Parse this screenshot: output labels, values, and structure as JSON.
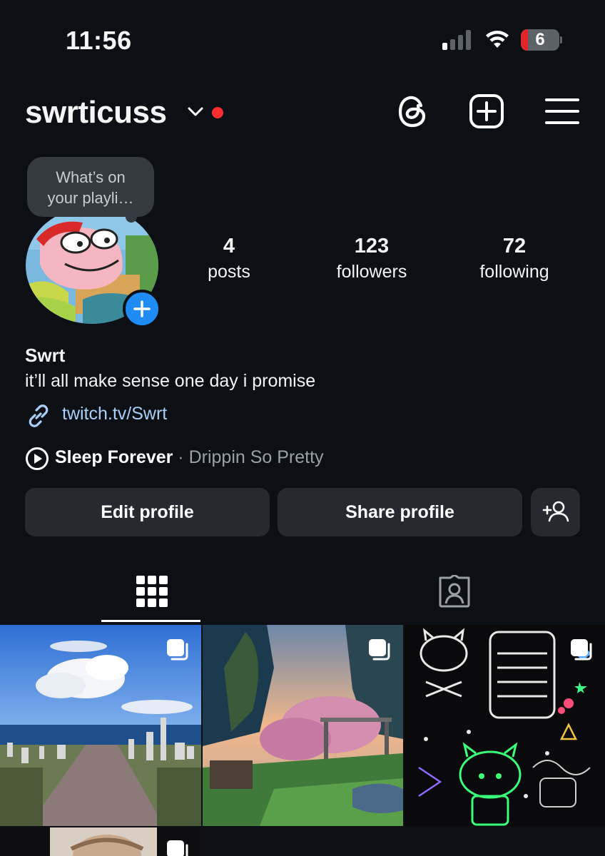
{
  "status_bar": {
    "time": "11:56",
    "battery_level": "6",
    "signal_bars_active": 1,
    "signal_bars_total": 4
  },
  "header": {
    "username": "swrticuss",
    "has_notification_dot": true,
    "icons": [
      "threads-icon",
      "create-post-icon",
      "menu-icon"
    ]
  },
  "note": {
    "text_line1": "What’s on",
    "text_line2": "your playli…"
  },
  "stats": {
    "posts": {
      "count": "4",
      "label": "posts"
    },
    "followers": {
      "count": "123",
      "label": "followers"
    },
    "following": {
      "count": "72",
      "label": "following"
    }
  },
  "bio": {
    "display_name": "Swrt",
    "text": "it’ll all make sense one day i promise",
    "link": "twitch.tv/Swrt"
  },
  "music": {
    "song": "Sleep Forever",
    "separator": " · ",
    "artist": "Drippin So Pretty"
  },
  "buttons": {
    "edit_profile": "Edit profile",
    "share_profile": "Share profile"
  },
  "tabs": {
    "active": "grid",
    "items": [
      "grid",
      "tagged"
    ]
  },
  "posts": [
    {
      "scene": "cemetery-by-sea",
      "multi": true
    },
    {
      "scene": "garden-gate-dusk",
      "multi": true
    },
    {
      "scene": "neon-kitty-collage",
      "multi": true
    },
    {
      "scene": "portrait-partial",
      "multi": true
    }
  ],
  "colors": {
    "background": "#0c1015",
    "button": "#262a30",
    "accent_blue": "#1f8cf5",
    "link": "#a9cff7",
    "notification": "#ff2e2e"
  }
}
